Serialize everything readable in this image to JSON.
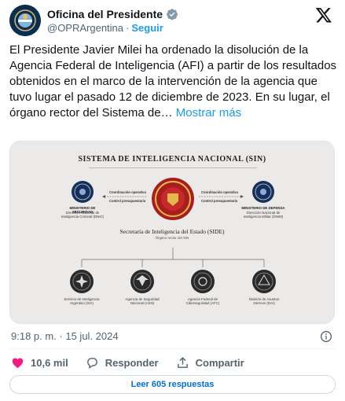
{
  "header": {
    "account_name": "Oficina del Presidente",
    "handle": "@OPRArgentina",
    "separator": "·",
    "follow_label": "Seguir"
  },
  "tweet": {
    "text": "El Presidente Javier Milei ha ordenado la disolución de la Agencia Federal de Inteligencia (AFI) a partir de los resultados obtenidos en el marco de la intervención de la agencia que tuvo lugar el pasado 12 de diciembre de 2023. En su lugar, el órgano rector del Sistema de…",
    "show_more": "Mostrar más",
    "timestamp": "9:18 p. m. · 15 jul. 2024"
  },
  "diagram": {
    "title": "SISTEMA DE INTELIGENCIA NACIONAL (SIN)",
    "left_org": {
      "title": "MINISTERIO DE SEGURIDAD",
      "sub": "Dirección Nacional de Inteligencia Criminal (DNIC)"
    },
    "right_org": {
      "title": "MINISTERIO DE DEFENSA",
      "sub": "Dirección Nacional de Inteligencia Militar (DNIM)"
    },
    "arrow_top": "Coordinación operativa",
    "arrow_bottom": "Control presupuestario",
    "center_title": "Secretaría de Inteligencia del Estado (SIDE)",
    "center_sub": "Órgano rector del SIN",
    "children": [
      {
        "label": "Servicio de Inteligencia Argentino (SIA)"
      },
      {
        "label": "Agencia de Seguridad Nacional (ASN)"
      },
      {
        "label": "Agencia Federal de Ciberseguridad (AFC)"
      },
      {
        "label": "División de Asuntos Internos (DAI)"
      }
    ]
  },
  "actions": {
    "likes": "10,6 mil",
    "reply_label": "Responder",
    "share_label": "Compartir"
  },
  "replies_button": "Leer 605 respuestas",
  "colors": {
    "link_blue": "#1d9bf0",
    "like_red": "#f91880",
    "verified_gray": "#829aab"
  }
}
